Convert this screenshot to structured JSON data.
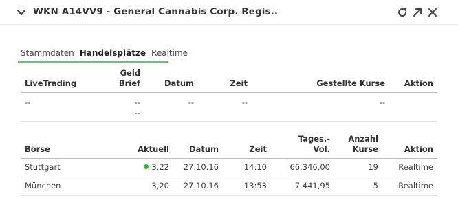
{
  "header": {
    "title": "WKN A14VV9 - General Cannabis Corp. Regis..",
    "icons": [
      "chevron-down-icon",
      "refresh-icon",
      "expand-icon",
      "close-icon"
    ]
  },
  "tabs": [
    {
      "label": "Stammdaten",
      "active": false
    },
    {
      "label": "Handelsplätze",
      "active": true
    },
    {
      "label": "Realtime",
      "active": false
    }
  ],
  "livetrading": {
    "headers": {
      "venue": "LiveTrading",
      "geld": "Geld",
      "brief": "Brief",
      "datum": "Datum",
      "zeit": "Zeit",
      "kurse": "Gestellte Kurse",
      "aktion": "Aktion"
    },
    "row": {
      "venue": "--",
      "geld": "--",
      "brief": "--",
      "datum": "--",
      "zeit": "--",
      "kurse": "--",
      "aktion": ""
    }
  },
  "exchanges": {
    "headers": {
      "boerse": "Börse",
      "aktuell": "Aktuell",
      "datum": "Datum",
      "zeit": "Zeit",
      "vol_line1": "Tages.-",
      "vol_line2": "Vol.",
      "anzahl_line1": "Anzahl",
      "anzahl_line2": "Kurse",
      "aktion": "Aktion"
    },
    "rows": [
      {
        "boerse": "Stuttgart",
        "aktuell": "3,22",
        "datum": "27.10.16",
        "zeit": "14:10",
        "vol": "66.346,00",
        "anzahl": "19",
        "aktion": "Realtime",
        "indicator": "green-dot"
      },
      {
        "boerse": "München",
        "aktuell": "3,20",
        "datum": "27.10.16",
        "zeit": "13:53",
        "vol": "7.441,95",
        "anzahl": "5",
        "aktion": "Realtime"
      }
    ]
  },
  "colors": {
    "accent_green": "#5ccb6a",
    "indicator_green": "#22c222"
  }
}
